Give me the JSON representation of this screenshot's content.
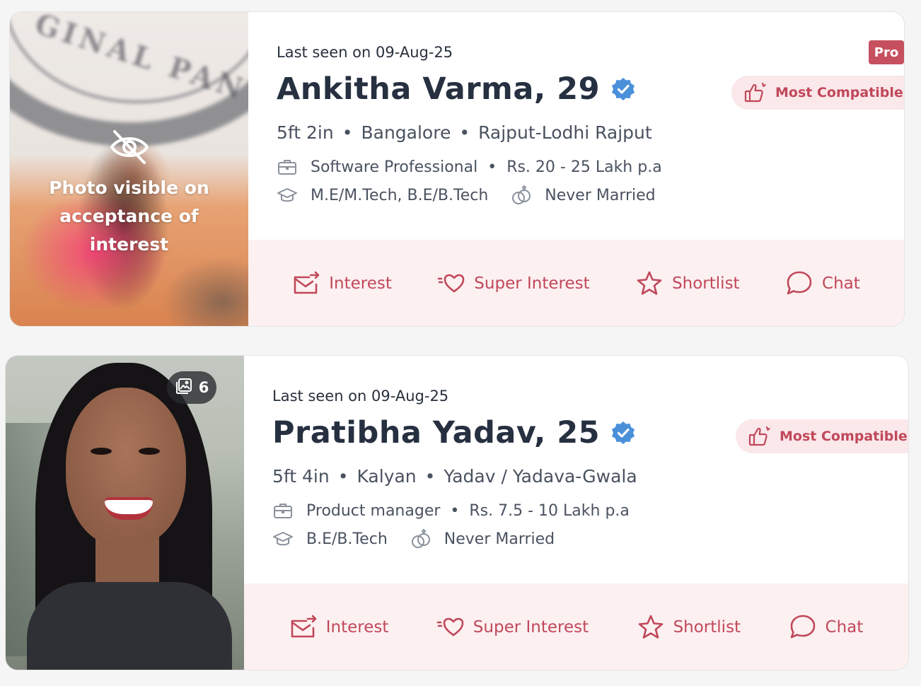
{
  "theme": {
    "accent": "#c0485a",
    "pro_badge": "#c6505f",
    "action_bar_bg": "#fdf0f1",
    "compat_bg": "#fbe8ea",
    "verified": "#4a90d9"
  },
  "profiles": [
    {
      "last_seen": "Last seen on 09-Aug-25",
      "name": "Ankitha Varma, 29",
      "height": "5ft 2in",
      "city": "Bangalore",
      "community": "Rajput-Lodhi Rajput",
      "profession": "Software Professional",
      "income": "Rs. 20 - 25 Lakh p.a",
      "education": "M.E/M.Tech, B.E/B.Tech",
      "marital_status": "Never Married",
      "pro_badge": "Pro",
      "compat_label": "Most Compatible",
      "photo_locked_text": "Photo visible on acceptance of interest",
      "photo_stamp": "GINAL PAN"
    },
    {
      "last_seen": "Last seen on 09-Aug-25",
      "name": "Pratibha Yadav, 25",
      "height": "5ft 4in",
      "city": "Kalyan",
      "community": "Yadav / Yadava-Gwala",
      "profession": "Product manager",
      "income": "Rs. 7.5 - 10 Lakh p.a",
      "education": "B.E/B.Tech",
      "marital_status": "Never Married",
      "compat_label": "Most Compatible",
      "photo_count": "6"
    }
  ],
  "actions": {
    "interest": "Interest",
    "super_interest": "Super Interest",
    "shortlist": "Shortlist",
    "chat": "Chat"
  },
  "separators": {
    "dot": "•"
  },
  "icons": {
    "hidden_photo": "eye-off-icon",
    "photo_count": "gallery-icon",
    "verified": "verified-badge-icon",
    "work": "briefcase-icon",
    "education": "graduation-cap-icon",
    "marital": "rings-icon",
    "compatible": "thumbs-up-icon",
    "interest": "envelope-send-icon",
    "super_interest": "heart-sparkle-icon",
    "shortlist": "star-icon",
    "chat": "chat-bubble-icon"
  }
}
